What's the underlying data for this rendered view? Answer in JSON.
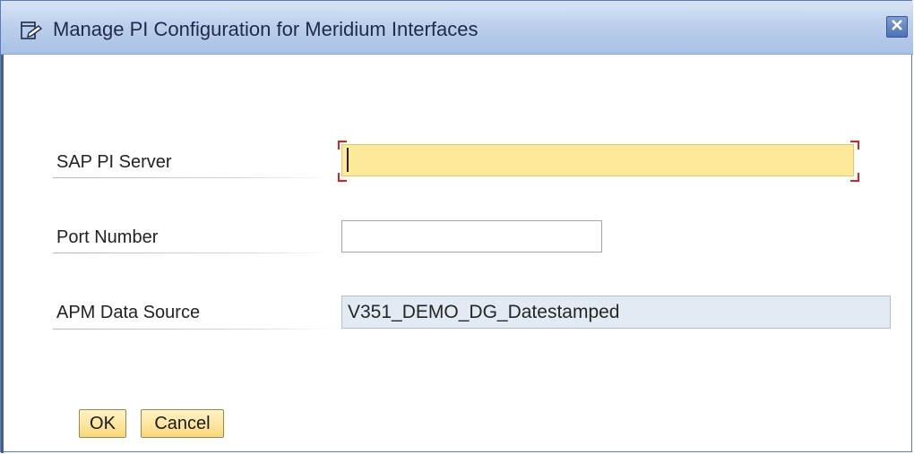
{
  "window": {
    "title": "Manage PI Configuration for Meridium Interfaces",
    "title_icon": "edit-window-icon",
    "close_icon": "close-icon"
  },
  "form": {
    "fields": [
      {
        "label": "SAP PI Server",
        "value": "",
        "state": "focused-required"
      },
      {
        "label": "Port Number",
        "value": ""
      },
      {
        "label": "APM Data Source",
        "value": "V351_DEMO_DG_Datestamped",
        "readonly": true
      }
    ]
  },
  "buttons": {
    "ok_label": "OK",
    "cancel_label": "Cancel"
  },
  "colors": {
    "titlebar": "#bdd0ec",
    "required_field_bg": "#fde99a",
    "required_marker": "#e02020",
    "readonly_field_bg": "#e2eaf3",
    "button_bg": "#fde49a"
  }
}
